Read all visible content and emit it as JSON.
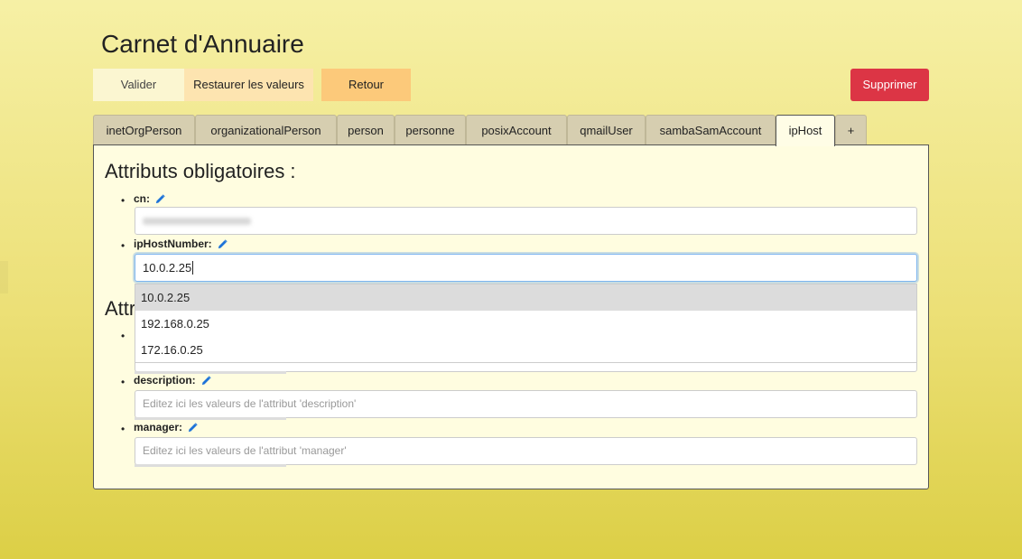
{
  "app": {
    "title": "Carnet d'Annuaire"
  },
  "toolbar": {
    "valider_label": "Valider",
    "restore_label": "Restaurer les valeurs",
    "retour_label": "Retour",
    "delete_label": "Supprimer"
  },
  "tabs": [
    {
      "label": "inetOrgPerson"
    },
    {
      "label": "organizationalPerson"
    },
    {
      "label": "person"
    },
    {
      "label": "personne"
    },
    {
      "label": "posixAccount"
    },
    {
      "label": "qmailUser"
    },
    {
      "label": "sambaSamAccount"
    },
    {
      "label": "ipHost"
    },
    {
      "label": "+"
    }
  ],
  "active_tab": "ipHost",
  "required": {
    "title": "Attributs obligatoires :",
    "cn_label": "cn:",
    "ip_label": "ipHostNumber:",
    "ip_value": "10.0.2.25"
  },
  "optional": {
    "title_visible": "Attr",
    "description_label": "description:",
    "description_placeholder": "Editez ici les valeurs de l'attribut 'description'",
    "manager_label": "manager:",
    "manager_placeholder": "Editez ici les valeurs de l'attribut 'manager'"
  },
  "autocomplete": [
    {
      "value": "10.0.2.25"
    },
    {
      "value": "192.168.0.25"
    },
    {
      "value": "172.16.0.25"
    }
  ],
  "colors": {
    "accent_delete": "#dc3545",
    "focus_border": "#7db5ef",
    "pencil_icon": "#1e73d8"
  }
}
